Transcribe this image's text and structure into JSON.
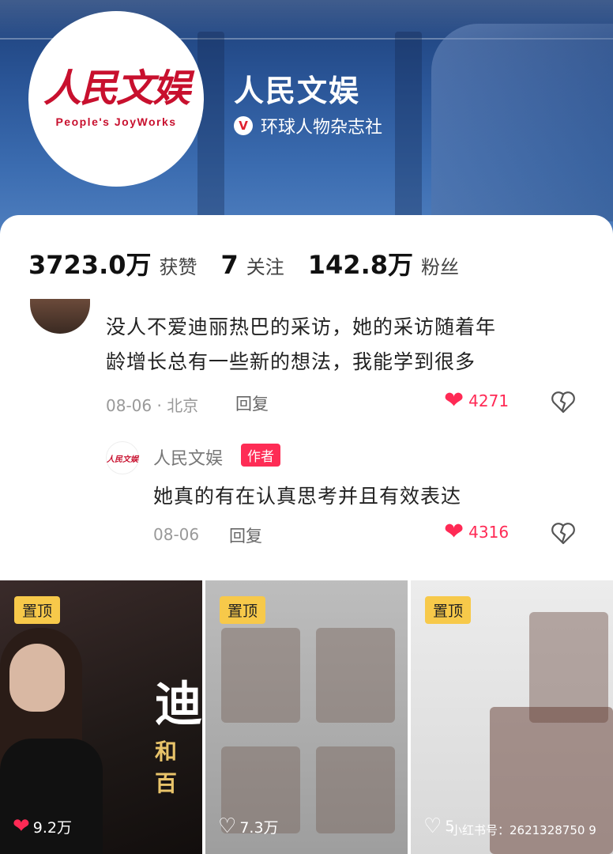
{
  "profile": {
    "logo_cn": "人民文娱",
    "logo_en": "People's JoyWorks",
    "name": "人民文娱",
    "verify_badge": "V",
    "verified_org": "环球人物杂志社"
  },
  "stats": [
    {
      "value": "3723.0万",
      "label": "获赞"
    },
    {
      "value": "7",
      "label": "关注"
    },
    {
      "value": "142.8万",
      "label": "粉丝"
    }
  ],
  "comment": {
    "text_line1": "没人不爱迪丽热巴的采访，她的采访随着年",
    "text_line2": "龄增长总有一些新的想法，我能学到很多",
    "meta": "08-06 · 北京",
    "reply_label": "回复",
    "likes": "4271"
  },
  "reply": {
    "avatar_text": "人民文娱",
    "author": "人民文娱",
    "tag": "作者",
    "text": "她真的有在认真思考并且有效表达",
    "meta": "08-06",
    "reply_label": "回复",
    "likes": "4316"
  },
  "videos": [
    {
      "pin": "置顶",
      "likes": "9.2万",
      "title_char": "迪",
      "gold_char": "和 百"
    },
    {
      "pin": "置顶",
      "likes": "7.3万"
    },
    {
      "pin": "置顶",
      "likes": "5",
      "watermark": "小红书号：2621328750 9"
    }
  ],
  "colors": {
    "accent": "#fe2c55",
    "brand_red": "#c8102e",
    "pin_yellow": "#f7c94a"
  }
}
